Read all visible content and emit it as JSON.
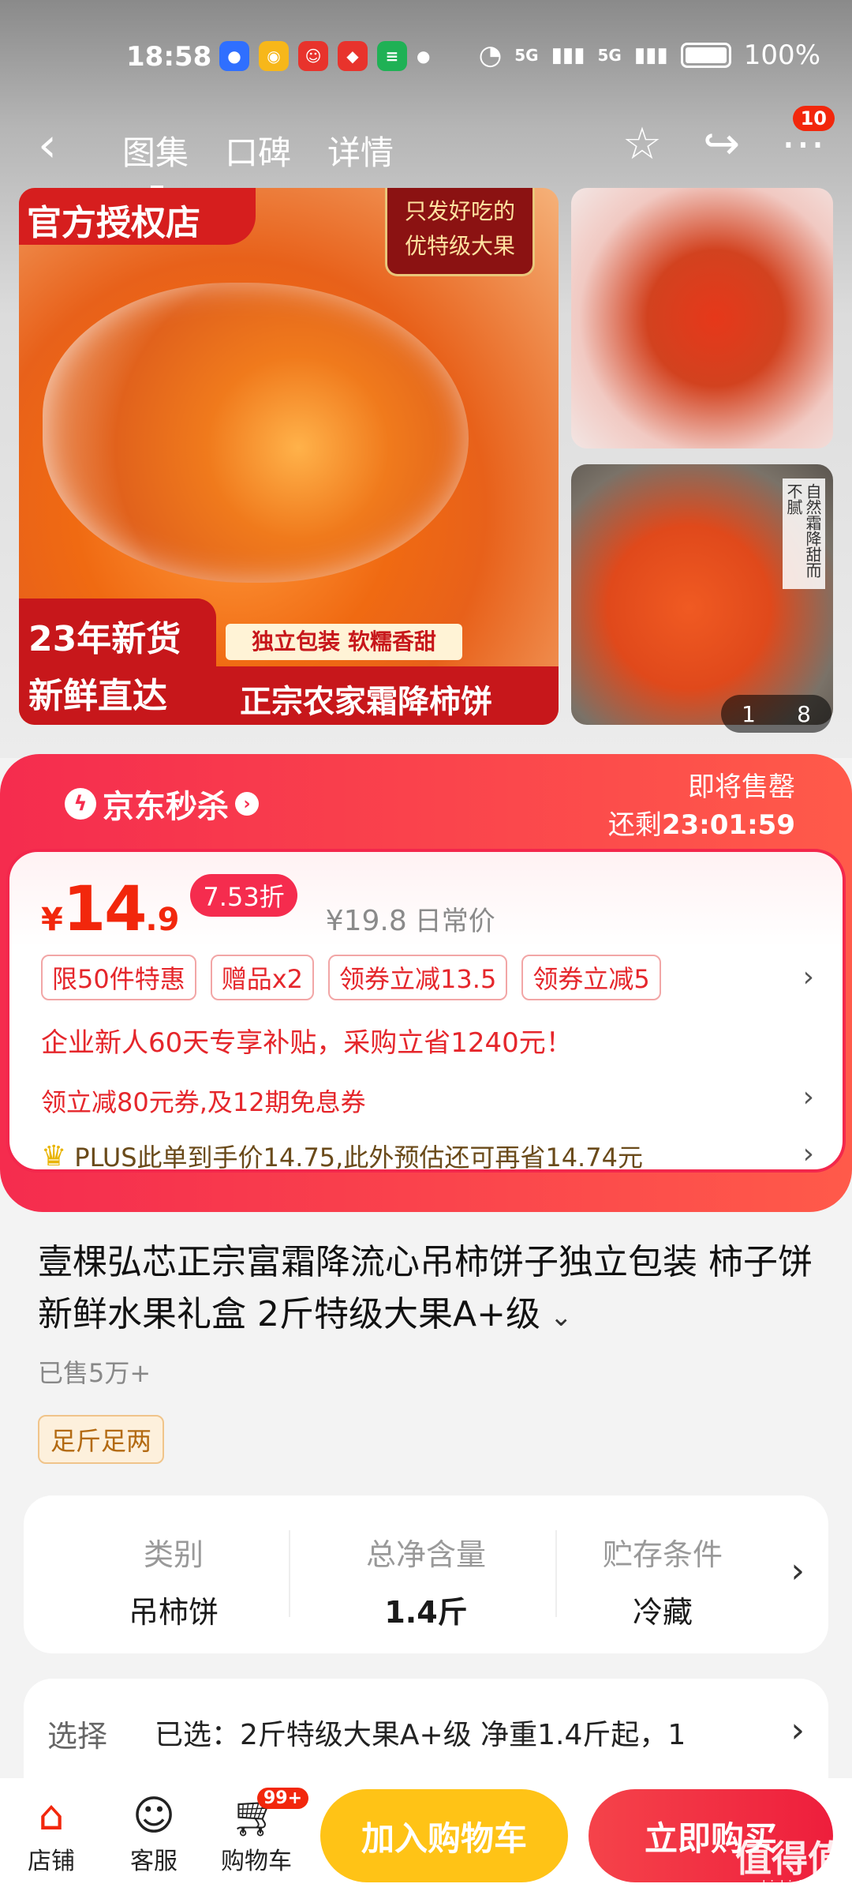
{
  "status_bar": {
    "time": "18:58",
    "signal_1": "5G",
    "signal_2": "5G",
    "battery": "100%"
  },
  "nav": {
    "tabs": [
      {
        "label": "图集",
        "active": true
      },
      {
        "label": "口碑",
        "active": false
      },
      {
        "label": "详情",
        "active": false
      }
    ],
    "badge": "10"
  },
  "gallery": {
    "main": {
      "banner": "官方授权店",
      "corner_line1": "只发好吃的",
      "corner_line2": "优特级大果",
      "bottom_left_line1": "23年新货",
      "bottom_left_line2": "新鲜直达",
      "tag": "独立包装  软糯香甜",
      "bottom_right": "正宗农家霜降柿饼"
    },
    "thumb2_label": "自然霜降甜而不腻",
    "counter_current": "1",
    "counter_total": "8"
  },
  "flash_sale": {
    "logo": "京东秒杀",
    "status": "即将售罄",
    "countdown_prefix": "还剩",
    "countdown": "23:01:59"
  },
  "price": {
    "yen": "¥",
    "integer": "14",
    "decimal": ".9",
    "discount": "7.53折",
    "original": "¥19.8",
    "original_label": "日常价"
  },
  "promo_tags": [
    "限50件特惠",
    "赠品x2",
    "领券立减13.5",
    "领券立减5"
  ],
  "new_user_text": "企业新人60天专享补贴，采购立省1240元！",
  "coupon_text": "领立减80元券,及12期免息券",
  "plus_text": "PLUS此单到手价14.75,此外预估还可再省14.74元",
  "product": {
    "title": "壹棵弘芯正宗富霜降流心吊柿饼子独立包装 柿子饼新鲜水果礼盒 2斤特级大果A+级",
    "sold": "已售5万+",
    "weight_tag": "足斤足两"
  },
  "specs": [
    {
      "label": "类别",
      "value": "吊柿饼"
    },
    {
      "label": "总净含量",
      "value": "1.4斤"
    },
    {
      "label": "贮存条件",
      "value": "冷藏"
    }
  ],
  "selection": {
    "label": "选择",
    "value": "已选：2斤特级大果A+级 净重1.4斤起，1"
  },
  "bottom_bar": {
    "store": "店铺",
    "service": "客服",
    "cart": "购物车",
    "cart_badge": "99+",
    "add_to_cart": "加入购物车",
    "buy_now": "立即购买"
  },
  "watermark": {
    "main": "值得值",
    "sub": "zhizhizhi.com"
  },
  "colors": {
    "accent_red": "#f2270c",
    "flash_red": "#f52c4e",
    "cart_yellow": "#ffc316"
  }
}
